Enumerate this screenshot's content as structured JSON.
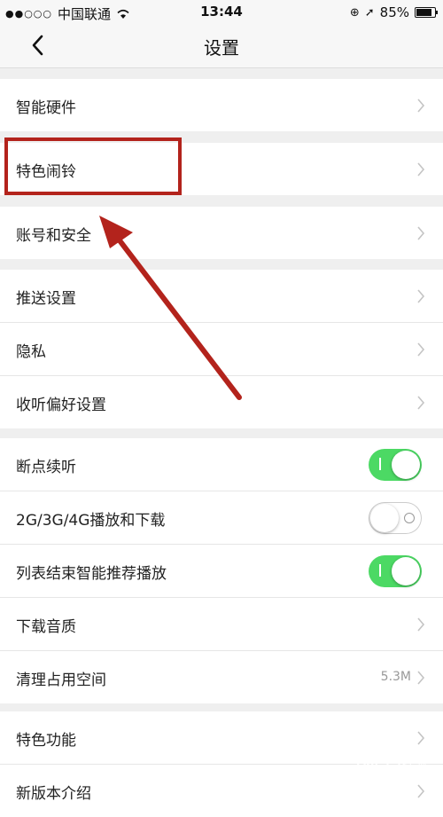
{
  "status_bar": {
    "carrier": "中国联通",
    "time": "13:44",
    "battery": "85%"
  },
  "nav": {
    "title": "设置"
  },
  "groups": {
    "g1": [
      "智能硬件"
    ],
    "g2": [
      "特色闹铃"
    ],
    "g3": [
      "账号和安全"
    ],
    "g4": [
      "推送设置",
      "隐私",
      "收听偏好设置"
    ],
    "g5": [
      "断点续听",
      "2G/3G/4G播放和下载",
      "列表结束智能推荐播放",
      "下载音质",
      "清理占用空间"
    ],
    "g6": [
      "特色功能",
      "新版本介绍"
    ]
  },
  "toggles": {
    "resume": true,
    "mobile_data": false,
    "auto_recommend": true
  },
  "cache_size": "5.3M",
  "colors": {
    "toggle_on": "#4cd964",
    "highlight": "#b3231c"
  }
}
